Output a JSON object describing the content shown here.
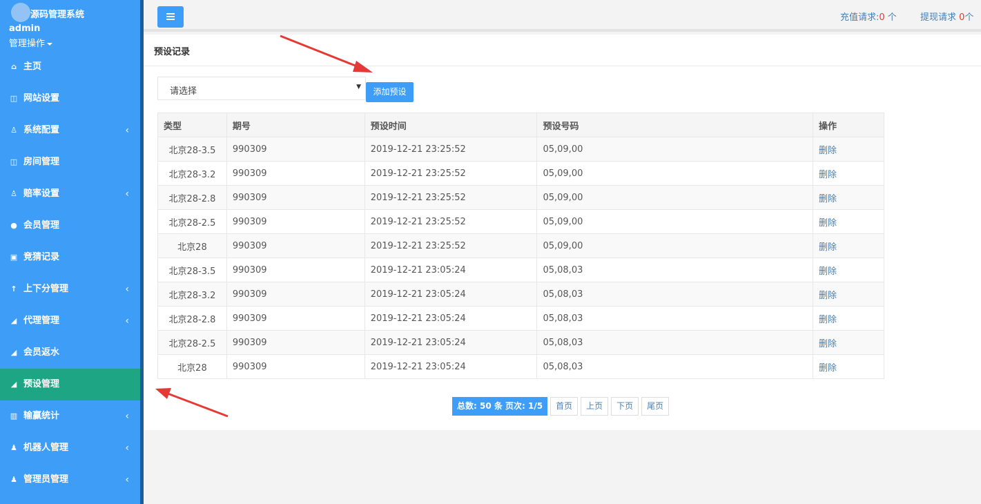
{
  "brand": {
    "title": "源码管理系统",
    "user": "admin",
    "ops": "管理操作"
  },
  "nav": [
    {
      "label": "主页",
      "icon": "home-icon",
      "glyph": "⌂",
      "chevron": false,
      "active": false
    },
    {
      "label": "网站设置",
      "icon": "columns-icon",
      "glyph": "◫",
      "chevron": false,
      "active": false
    },
    {
      "label": "系统配置",
      "icon": "flask-icon",
      "glyph": "♙",
      "chevron": true,
      "active": false
    },
    {
      "label": "房间管理",
      "icon": "columns-icon",
      "glyph": "◫",
      "chevron": false,
      "active": false
    },
    {
      "label": "赔率设置",
      "icon": "flask-icon",
      "glyph": "♙",
      "chevron": true,
      "active": false
    },
    {
      "label": "会员管理",
      "icon": "user-icon",
      "glyph": "●",
      "chevron": false,
      "active": false
    },
    {
      "label": "竞猜记录",
      "icon": "car-icon",
      "glyph": "▣",
      "chevron": false,
      "active": false
    },
    {
      "label": "上下分管理",
      "icon": "arrow-up-icon",
      "glyph": "↑",
      "chevron": true,
      "active": false
    },
    {
      "label": "代理管理",
      "icon": "paper-plane-icon",
      "glyph": "◢",
      "chevron": true,
      "active": false
    },
    {
      "label": "会员返水",
      "icon": "paper-plane-icon",
      "glyph": "◢",
      "chevron": false,
      "active": false
    },
    {
      "label": "预设管理",
      "icon": "paper-plane-icon",
      "glyph": "◢",
      "chevron": false,
      "active": true
    },
    {
      "label": "输赢统计",
      "icon": "bar-chart-icon",
      "glyph": "▥",
      "chevron": true,
      "active": false
    },
    {
      "label": "机器人管理",
      "icon": "person-icon",
      "glyph": "♟",
      "chevron": true,
      "active": false
    },
    {
      "label": "管理员管理",
      "icon": "person-icon",
      "glyph": "♟",
      "chevron": true,
      "active": false
    }
  ],
  "top": {
    "recharge_label": "充值请求:",
    "recharge_count": "0",
    "recharge_unit": " 个",
    "withdraw_label": "提现请求",
    "withdraw_count": "0",
    "withdraw_unit": "个"
  },
  "panel": {
    "title": "预设记录"
  },
  "select": {
    "value": "请选择"
  },
  "add_button": "添加预设",
  "table": {
    "headers": [
      "类型",
      "期号",
      "预设时间",
      "预设号码",
      "操作"
    ],
    "rows": [
      [
        "北京28-3.5",
        "990309",
        "2019-12-21 23:25:52",
        "05,09,00",
        "删除"
      ],
      [
        "北京28-3.2",
        "990309",
        "2019-12-21 23:25:52",
        "05,09,00",
        "删除"
      ],
      [
        "北京28-2.8",
        "990309",
        "2019-12-21 23:25:52",
        "05,09,00",
        "删除"
      ],
      [
        "北京28-2.5",
        "990309",
        "2019-12-21 23:25:52",
        "05,09,00",
        "删除"
      ],
      [
        "北京28",
        "990309",
        "2019-12-21 23:25:52",
        "05,09,00",
        "删除"
      ],
      [
        "北京28-3.5",
        "990309",
        "2019-12-21 23:05:24",
        "05,08,03",
        "删除"
      ],
      [
        "北京28-3.2",
        "990309",
        "2019-12-21 23:05:24",
        "05,08,03",
        "删除"
      ],
      [
        "北京28-2.8",
        "990309",
        "2019-12-21 23:05:24",
        "05,08,03",
        "删除"
      ],
      [
        "北京28-2.5",
        "990309",
        "2019-12-21 23:05:24",
        "05,08,03",
        "删除"
      ],
      [
        "北京28",
        "990309",
        "2019-12-21 23:05:24",
        "05,08,03",
        "删除"
      ]
    ]
  },
  "pager": {
    "total": "总数: 50 条 页次: 1/5",
    "first": "首页",
    "prev": "上页",
    "next": "下页",
    "last": "尾页"
  },
  "colors": {
    "sidebar": "#3d9df7",
    "active": "#1ea583",
    "link": "#4a7fb3",
    "alert": "#e8382b",
    "arrow": "#e53935"
  }
}
